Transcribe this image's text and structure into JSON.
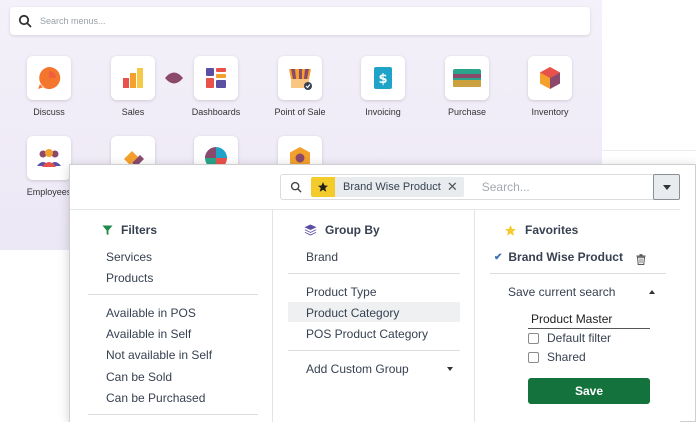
{
  "home": {
    "search_placeholder": "Search menus...",
    "apps": [
      {
        "label": "Discuss",
        "icon": "discuss-icon"
      },
      {
        "label": "Sales",
        "icon": "sales-icon"
      },
      {
        "label": "Dashboards",
        "icon": "dashboards-icon"
      },
      {
        "label": "Point of Sale",
        "icon": "point-of-sale-icon"
      },
      {
        "label": "Invoicing",
        "icon": "invoicing-icon"
      },
      {
        "label": "Purchase",
        "icon": "purchase-icon"
      },
      {
        "label": "Inventory",
        "icon": "inventory-icon"
      },
      {
        "label": "Employees",
        "icon": "employees-icon"
      }
    ]
  },
  "search": {
    "facet": "Brand Wise Product",
    "placeholder": "Search..."
  },
  "filters": {
    "title": "Filters",
    "items": [
      "Services",
      "Products",
      "Available in POS",
      "Available in Self",
      "Not available in Self",
      "Can be Sold",
      "Can be Purchased"
    ]
  },
  "group_by": {
    "title": "Group By",
    "items": [
      "Brand",
      "Product Type",
      "Product Category",
      "POS Product Category"
    ],
    "custom": "Add Custom Group"
  },
  "favorites": {
    "title": "Favorites",
    "active": "Brand Wise Product",
    "save_current": "Save current search",
    "name_value": "Product Master",
    "default_filter": "Default filter",
    "shared": "Shared",
    "save_label": "Save"
  },
  "colors": {
    "accent_green": "#14733c",
    "star_yellow": "#f3cc2b",
    "filter_green": "#1f8a4c",
    "group_purple": "#5b4fa3"
  }
}
